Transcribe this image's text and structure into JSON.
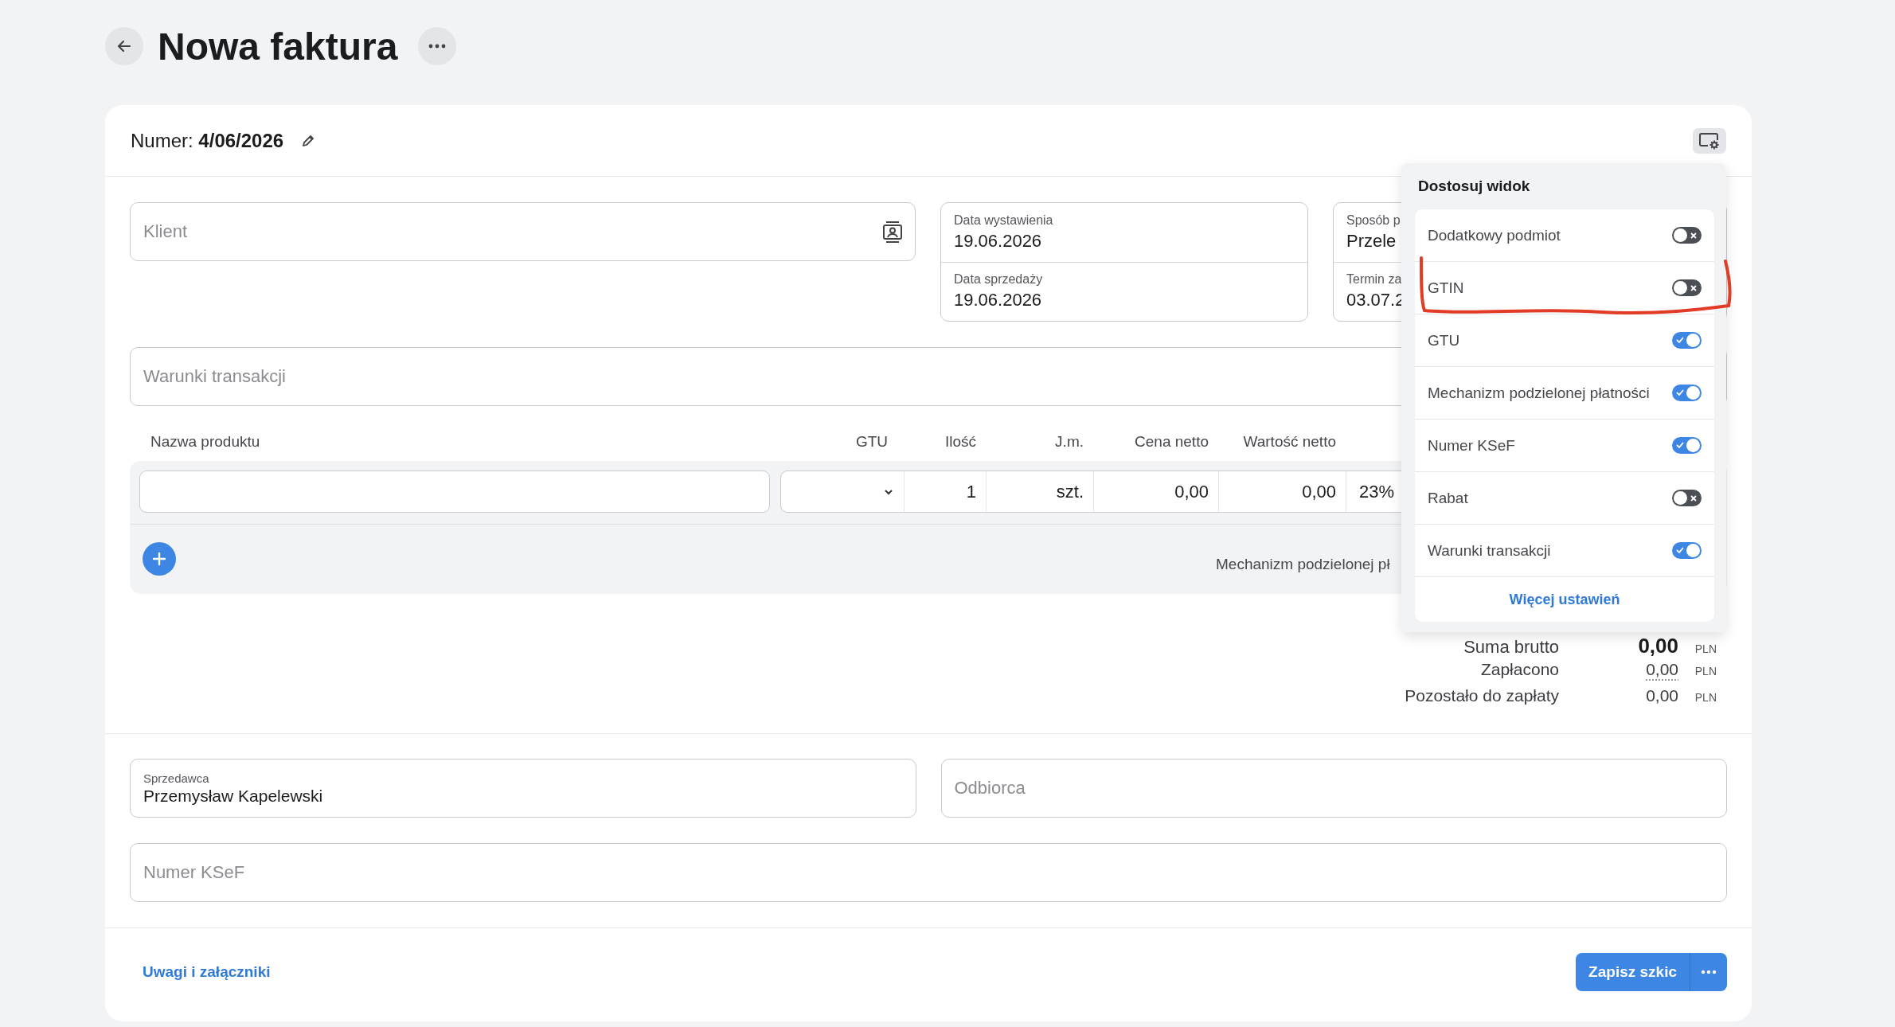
{
  "page": {
    "title": "Nowa faktura"
  },
  "invoice_number": {
    "label": "Numer:",
    "value": "4/06/2026"
  },
  "client_field": {
    "placeholder": "Klient"
  },
  "dates": [
    {
      "label": "Data wystawienia",
      "value": "19.06.2026"
    },
    {
      "label": "Data sprzedaży",
      "value": "19.06.2026"
    }
  ],
  "payment": [
    {
      "label": "Sposób p",
      "value": "Przele"
    },
    {
      "label": "Termin za",
      "value": "03.07.2"
    }
  ],
  "terms_field": {
    "placeholder": "Warunki transakcji"
  },
  "items_table": {
    "columns": [
      "Nazwa produktu",
      "GTU",
      "Ilość",
      "J.m.",
      "Cena netto",
      "Wartość netto"
    ],
    "rows": [
      {
        "quantity": "1",
        "unit": "szt.",
        "net_price": "0,00",
        "net_value": "0,00",
        "vat": "23%"
      }
    ],
    "split_payment_label": "Mechanizm podzielonej pł"
  },
  "totals": [
    {
      "kind": "gross",
      "label": "Suma brutto",
      "value": "0,00",
      "currency": "PLN"
    },
    {
      "kind": "paid",
      "label": "Zapłacono",
      "value": "0,00",
      "currency": "PLN"
    },
    {
      "kind": "due",
      "label": "Pozostało do zapłaty",
      "value": "0,00",
      "currency": "PLN"
    }
  ],
  "seller_field": {
    "label": "Sprzedawca",
    "value": "Przemysław Kapelewski"
  },
  "recipient_field": {
    "placeholder": "Odbiorca"
  },
  "ksef_field": {
    "placeholder": "Numer KSeF"
  },
  "footer": {
    "link": "Uwagi i załączniki",
    "save_button": "Zapisz szkic"
  },
  "view_menu": {
    "title": "Dostosuj widok",
    "more_link": "Więcej ustawień",
    "options": [
      {
        "label": "Dodatkowy podmiot",
        "on": false,
        "highlighted": false
      },
      {
        "label": "GTIN",
        "on": false,
        "highlighted": true
      },
      {
        "label": "GTU",
        "on": true,
        "highlighted": false
      },
      {
        "label": "Mechanizm podzielonej płatności",
        "on": true,
        "highlighted": false
      },
      {
        "label": "Numer KSeF",
        "on": true,
        "highlighted": false
      },
      {
        "label": "Rabat",
        "on": false,
        "highlighted": false
      },
      {
        "label": "Warunki transakcji",
        "on": true,
        "highlighted": false
      }
    ]
  }
}
